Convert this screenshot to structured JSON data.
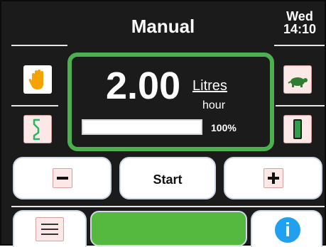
{
  "header": {
    "title": "Manual",
    "day": "Wed",
    "time": "14:10"
  },
  "rate": {
    "value": "2.00",
    "unit": "Litres",
    "per": "hour",
    "progress_label": "100%",
    "progress_fraction": 1.0
  },
  "buttons": {
    "start_label": "Start"
  },
  "icons": {
    "hand": "hand-icon",
    "ramp": "ramp-profile-icon",
    "turtle": "turtle-icon",
    "battery": "battery-icon",
    "minus": "minus-icon",
    "plus": "plus-icon",
    "menu": "menu-icon",
    "info": "info-icon"
  },
  "colors": {
    "background": "#1b1b1b",
    "panel_border": "#4caf50",
    "status_green": "#55b93f",
    "info_blue": "#21a0f0",
    "icon_bg_pink": "#fde8e8",
    "battery_green": "#2e9e4a"
  }
}
